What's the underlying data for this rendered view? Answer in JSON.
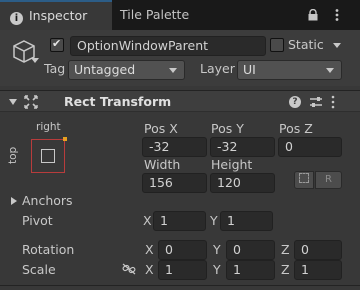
{
  "tabs": [
    {
      "label": "Inspector",
      "active": true,
      "icon": "info-icon"
    },
    {
      "label": "Tile Palette",
      "active": false
    }
  ],
  "header": {
    "active": true,
    "object_name": "OptionWindowParent",
    "static_label": "Static",
    "static_checked": false,
    "tag_label": "Tag",
    "tag_value": "Untagged",
    "layer_label": "Layer",
    "layer_value": "UI"
  },
  "component": {
    "title": "Rect Transform",
    "expanded": true
  },
  "anchor_preset": {
    "horizontal": "right",
    "vertical": "top"
  },
  "rect": {
    "pos_x_label": "Pos X",
    "pos_x": "-32",
    "pos_y_label": "Pos Y",
    "pos_y": "-32",
    "pos_z_label": "Pos Z",
    "pos_z": "0",
    "width_label": "Width",
    "width": "156",
    "height_label": "Height",
    "height": "120",
    "raw_button": "R"
  },
  "anchors_label": "Anchors",
  "pivot": {
    "label": "Pivot",
    "x_label": "X",
    "x": "1",
    "y_label": "Y",
    "y": "1"
  },
  "rotation": {
    "label": "Rotation",
    "x_label": "X",
    "x": "0",
    "y_label": "Y",
    "y": "0",
    "z_label": "Z",
    "z": "0"
  },
  "scale": {
    "label": "Scale",
    "x_label": "X",
    "x": "1",
    "y_label": "Y",
    "y": "1",
    "z_label": "Z",
    "z": "1"
  },
  "colors": {
    "tab_active_accent": "#2c5d87",
    "anchor_frame": "#b83c3c",
    "anchor_pivot": "#e8a020",
    "background": "#383838"
  }
}
